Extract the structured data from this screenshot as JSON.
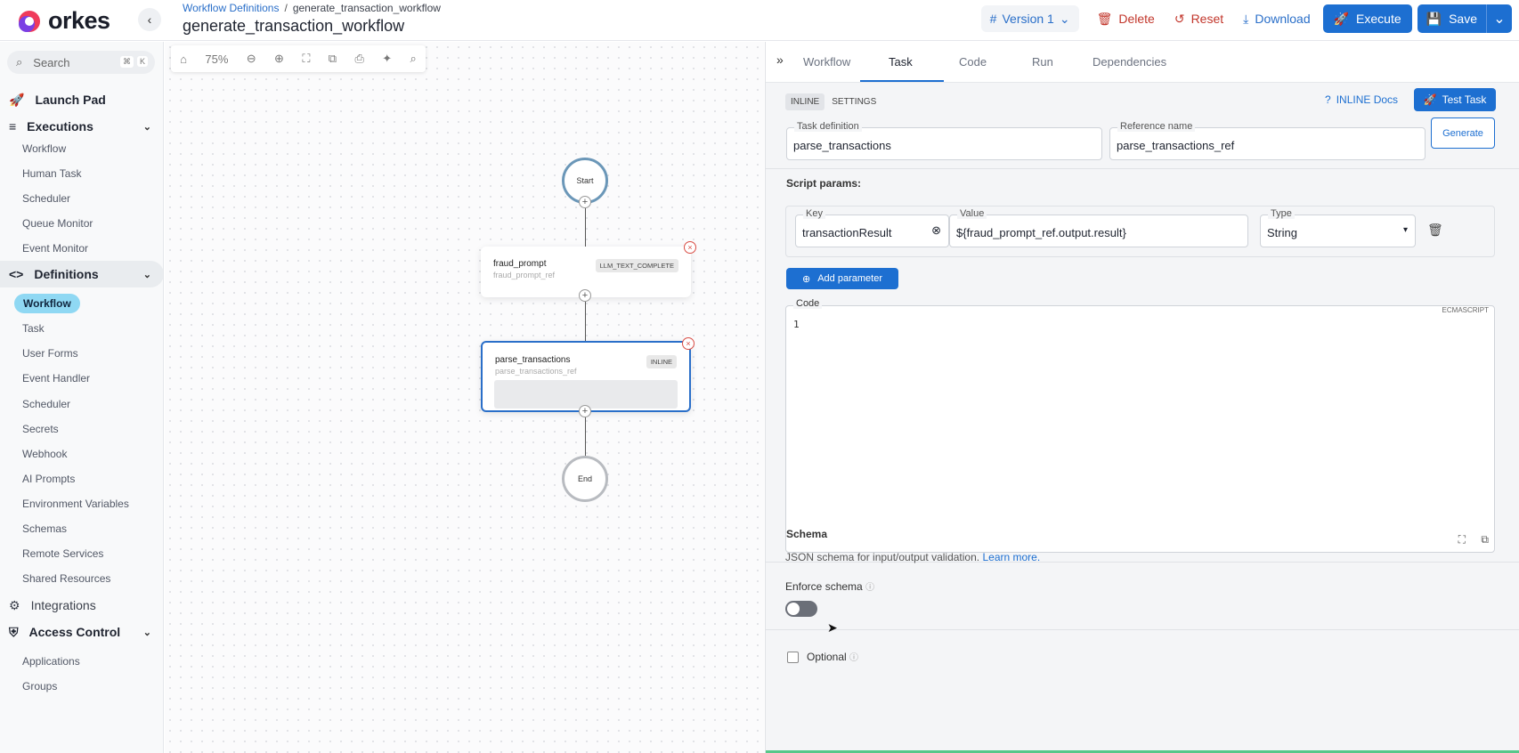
{
  "app": {
    "brand": "orkes",
    "breadcrumb_link": "Workflow Definitions",
    "breadcrumb_sep": "/",
    "breadcrumb_current": "generate_transaction_workflow",
    "title": "generate_transaction_workflow"
  },
  "toolbar": {
    "version_label": "Version 1",
    "delete_label": "Delete",
    "reset_label": "Reset",
    "download_label": "Download",
    "execute_label": "Execute",
    "save_label": "Save"
  },
  "sidebar": {
    "search_placeholder": "Search",
    "search_kbd1": "⌘",
    "search_kbd2": "K",
    "launch_pad": "Launch Pad",
    "executions": "Executions",
    "executions_items": [
      "Workflow",
      "Human Task",
      "Scheduler",
      "Queue Monitor",
      "Event Monitor"
    ],
    "definitions": "Definitions",
    "definitions_items": [
      "Workflow",
      "Task",
      "User Forms",
      "Event Handler",
      "Scheduler",
      "Secrets",
      "Webhook",
      "AI Prompts",
      "Environment Variables",
      "Schemas",
      "Remote Services",
      "Shared Resources"
    ],
    "integrations": "Integrations",
    "access_control": "Access Control",
    "access_items": [
      "Applications",
      "Groups"
    ]
  },
  "canvas": {
    "zoom": "75%",
    "start_label": "Start",
    "end_label": "End",
    "tasks": [
      {
        "name": "fraud_prompt",
        "ref": "fraud_prompt_ref",
        "type": "LLM_TEXT_COMPLETE"
      },
      {
        "name": "parse_transactions",
        "ref": "parse_transactions_ref",
        "type": "INLINE"
      }
    ]
  },
  "panel": {
    "tabs": [
      "Workflow",
      "Task",
      "Code",
      "Run",
      "Dependencies"
    ],
    "active_tab": "Task",
    "subtabs": [
      "INLINE",
      "SETTINGS"
    ],
    "docs_label": "INLINE Docs",
    "test_task_label": "Test Task",
    "task_definition_label": "Task definition",
    "task_definition_value": "parse_transactions",
    "reference_name_label": "Reference name",
    "reference_name_value": "parse_transactions_ref",
    "generate_label": "Generate",
    "script_params_label": "Script params:",
    "key_label": "Key",
    "key_value": "transactionResult",
    "value_label": "Value",
    "value_value": "${fraud_prompt_ref.output.result}",
    "type_label": "Type",
    "type_value": "String",
    "add_parameter_label": "Add parameter",
    "code_label": "Code",
    "code_lang": "ECMASCRIPT",
    "code_line_number": "1",
    "schema_label": "Schema",
    "schema_desc": "JSON schema for input/output validation.",
    "learn_more": "Learn more.",
    "enforce_schema_label": "Enforce schema",
    "enforce_schema_on": false,
    "optional_label": "Optional",
    "optional_checked": false
  },
  "colors": {
    "accent": "#1d6fd1",
    "danger": "#c2362b",
    "active_nav": "#8fd8f3",
    "start_ring": "#6b97b8"
  }
}
